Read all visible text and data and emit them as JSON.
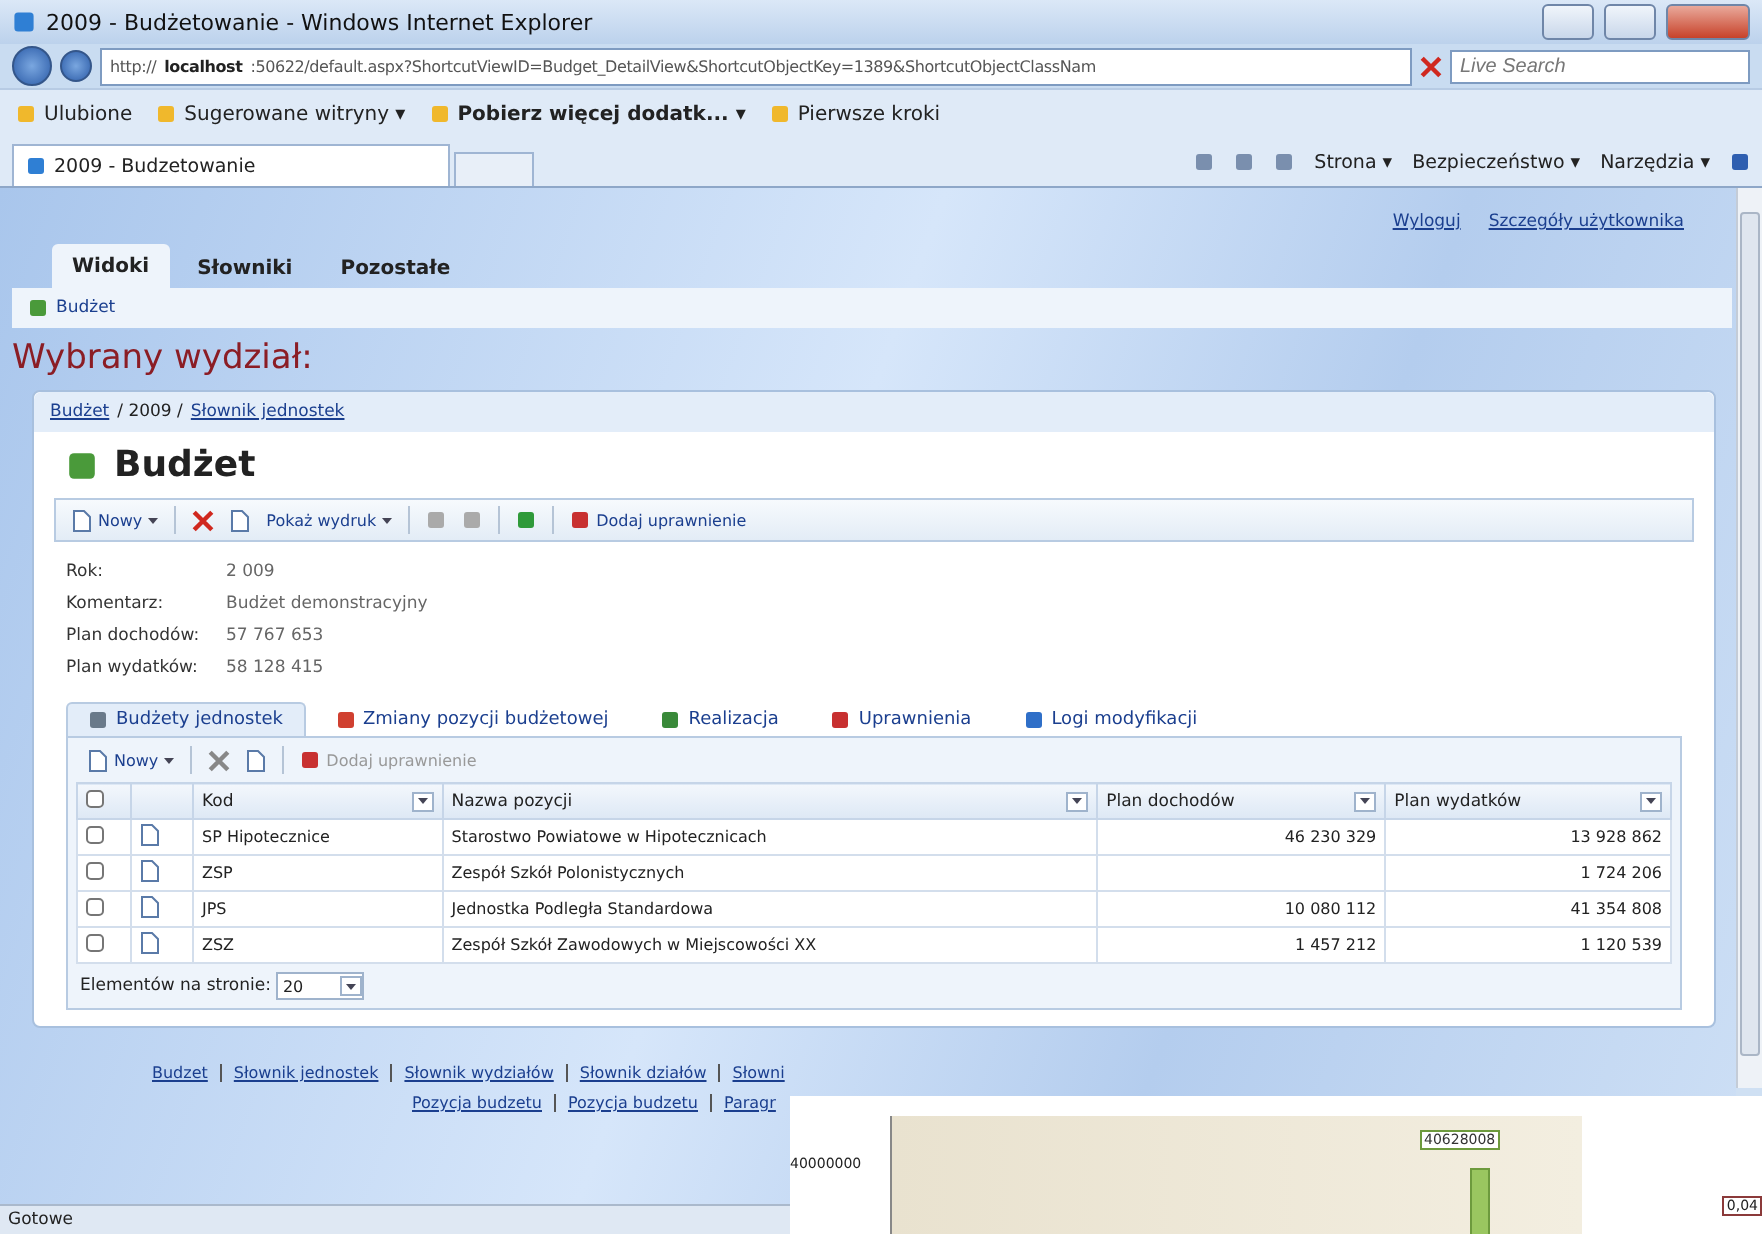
{
  "window": {
    "title": "2009 - Budżetowanie - Windows Internet Explorer"
  },
  "address": {
    "prefix": "http://",
    "host": "localhost",
    "rest": ":50622/default.aspx?ShortcutViewID=Budget_DetailView&ShortcutObjectKey=1389&ShortcutObjectClassNam"
  },
  "search": {
    "placeholder": "Live Search"
  },
  "favorites": [
    {
      "label": "Ulubione",
      "bold": false
    },
    {
      "label": "Sugerowane witryny ▾",
      "bold": false
    },
    {
      "label": "Pobierz więcej dodatk... ▾",
      "bold": true
    },
    {
      "label": "Pierwsze kroki",
      "bold": false
    }
  ],
  "browser_tab": {
    "title": "2009 - Budzetowanie"
  },
  "command_bar": [
    "Strona ▾",
    "Bezpieczeństwo ▾",
    "Narzędzia ▾"
  ],
  "user_links": [
    "Wyloguj",
    "Szczegóły użytkownika"
  ],
  "nav_tabs": [
    {
      "label": "Widoki",
      "selected": true
    },
    {
      "label": "Słowniki",
      "selected": false
    },
    {
      "label": "Pozostałe",
      "selected": false
    }
  ],
  "sub_nav": "Budżet",
  "heading": "Wybrany wydział:",
  "breadcrumb": [
    {
      "label": "Budżet",
      "link": true
    },
    {
      "label": "/ 2009 /",
      "link": false
    },
    {
      "label": "Słownik jednostek",
      "link": true
    }
  ],
  "title": "Budżet",
  "toolbar": {
    "new": "Nowy",
    "print": "Pokaż wydruk",
    "permission": "Dodaj uprawnienie"
  },
  "fields": [
    {
      "label": "Rok:",
      "value": "2 009"
    },
    {
      "label": "Komentarz:",
      "value": "Budżet demonstracyjny"
    },
    {
      "label": "Plan dochodów:",
      "value": "57 767 653"
    },
    {
      "label": "Plan wydatków:",
      "value": "58 128 415"
    }
  ],
  "detail_tabs": [
    {
      "label": "Budżety jednostek",
      "selected": true
    },
    {
      "label": "Zmiany pozycji budżetowej",
      "selected": false
    },
    {
      "label": "Realizacja",
      "selected": false
    },
    {
      "label": "Uprawnienia",
      "selected": false
    },
    {
      "label": "Logi modyfikacji",
      "selected": false
    }
  ],
  "grid_toolbar": {
    "new": "Nowy",
    "permission": "Dodaj uprawnienie"
  },
  "table": {
    "select_all_checked": false,
    "columns": [
      "Kod",
      "Nazwa pozycji",
      "Plan dochodów",
      "Plan wydatków"
    ],
    "rows": [
      {
        "checked": false,
        "cells": [
          "SP Hipotecznice",
          "Starostwo Powiatowe w Hipotecznicach",
          "46 230 329",
          "13 928 862"
        ]
      },
      {
        "checked": false,
        "cells": [
          "ZSP",
          "Zespół Szkół Polonistycznych",
          "",
          "1 724 206"
        ]
      },
      {
        "checked": false,
        "cells": [
          "JPS",
          "Jednostka Podległa Standardowa",
          "10 080 112",
          "41 354 808"
        ]
      },
      {
        "checked": false,
        "cells": [
          "ZSZ",
          "Zespół Szkół Zawodowych w Miejscowości XX",
          "1 457 212",
          "1 120 539"
        ]
      }
    ]
  },
  "pager": {
    "label": "Elementów na stronie:",
    "value": "20"
  },
  "footer_links": [
    [
      "Budzet",
      "Słownik jednostek",
      "Słownik wydziałów",
      "Słownik działów",
      "Słowni"
    ],
    [
      "Pozycja budzetu",
      "Pozycja budzetu",
      "Paragr"
    ]
  ],
  "status_bar": "Gotowe",
  "overlay": {
    "tick_label": "40000000",
    "value_label": "40628008",
    "corner_label": "0,04"
  }
}
